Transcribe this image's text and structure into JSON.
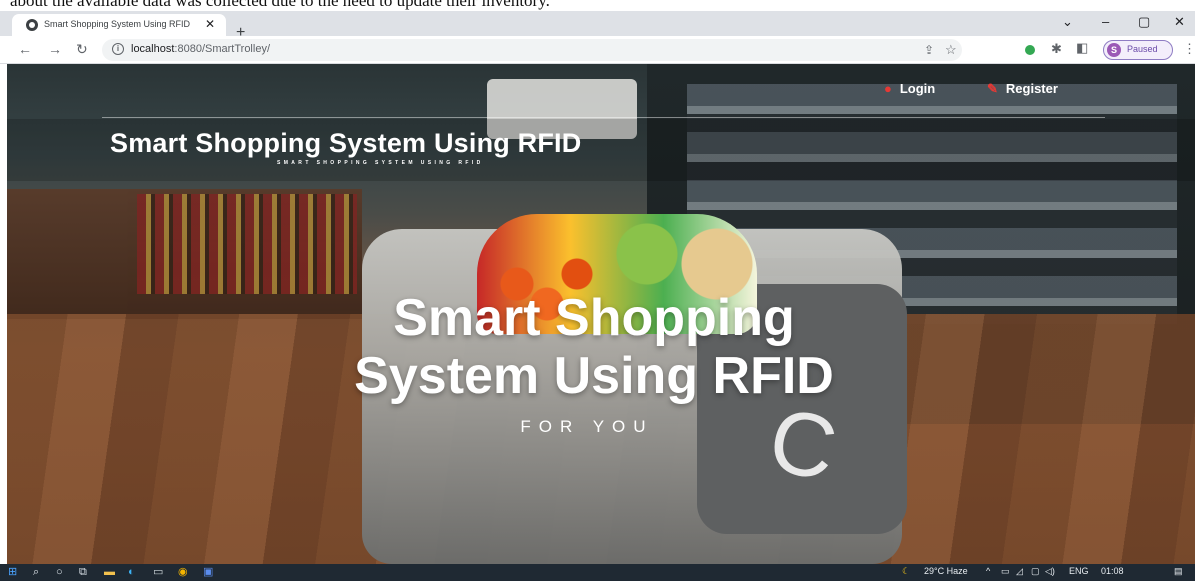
{
  "caption_strip": "about the available data was collected due to the need to update their inventory.",
  "browser": {
    "tab_title": "Smart Shopping System Using RFID",
    "url_host": "localhost",
    "url_path": ":8080/SmartTrolley/",
    "profile_initial": "S",
    "profile_status": "Paused"
  },
  "page": {
    "nav": {
      "login": "Login",
      "register": "Register"
    },
    "brand_title": "Smart Shopping System Using RFID",
    "brand_subtitle": "SMART SHOPPING SYSTEM USING RFID",
    "hero_line1": "Smart Shopping",
    "hero_line2": "System Using RFID",
    "hero_tagline": "FOR YOU"
  },
  "taskbar": {
    "weather": "29°C Haze",
    "language": "ENG",
    "time": "01:08"
  }
}
